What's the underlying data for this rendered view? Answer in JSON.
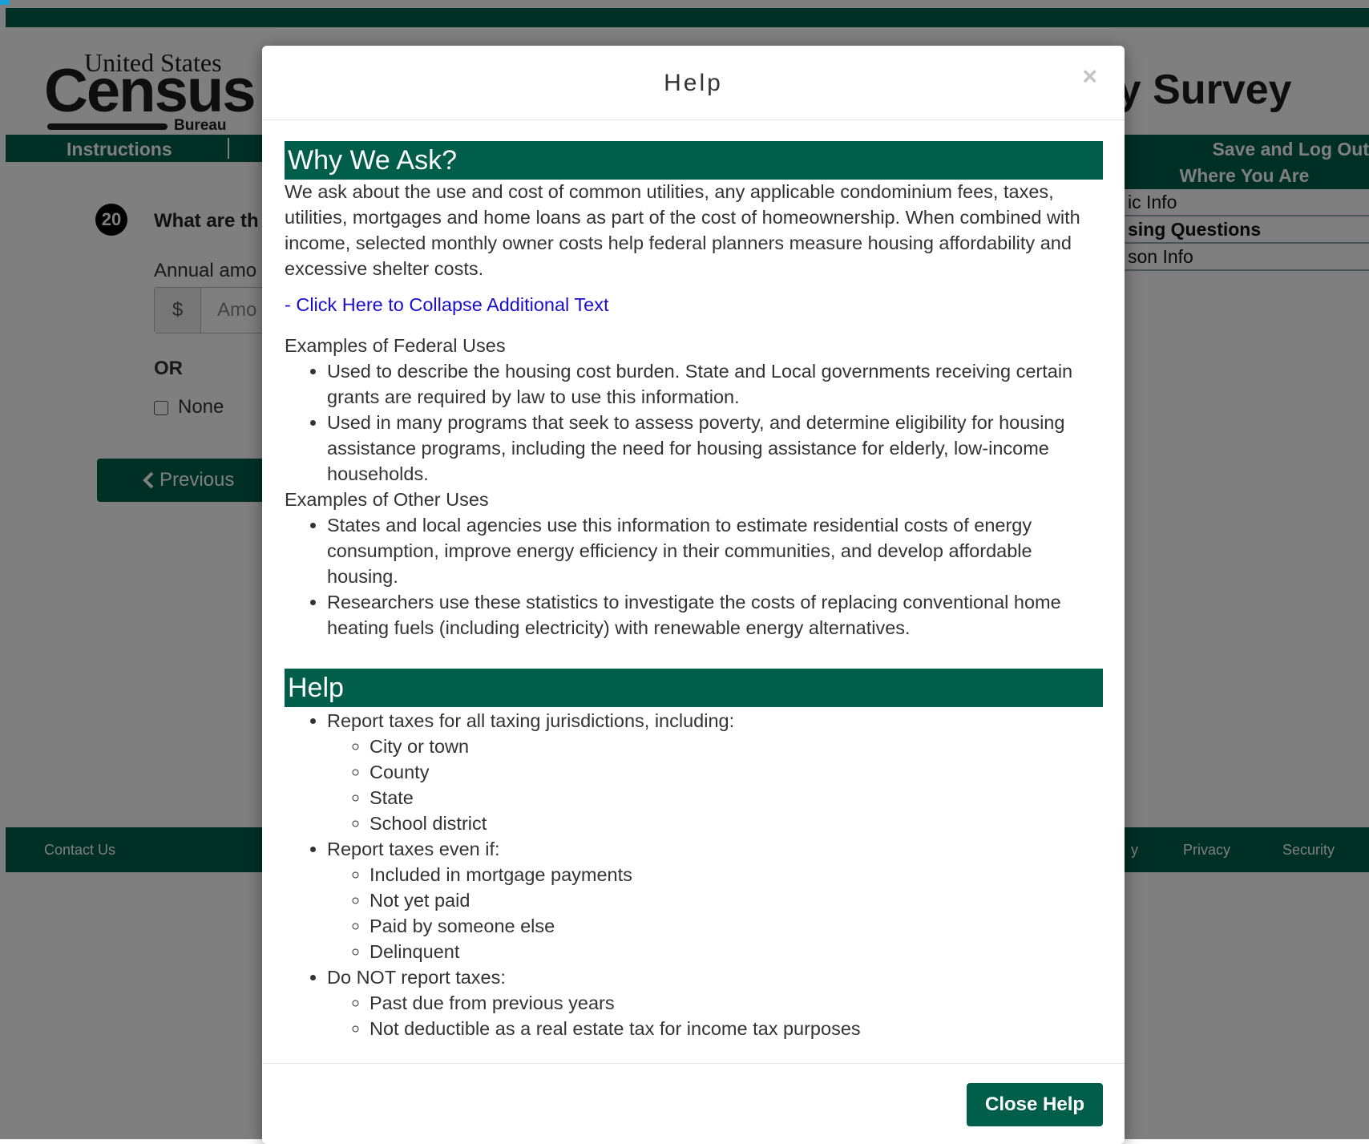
{
  "background": {
    "logo": {
      "top_line": "United States",
      "word": "Census",
      "bureau": "Bureau"
    },
    "survey_title": "ity Survey",
    "nav": {
      "instructions": "Instructions",
      "save_logout": "Save and Log Out"
    },
    "sidebar": {
      "title": "Where You Are",
      "items": [
        {
          "label": "ic Info"
        },
        {
          "label": "sing Questions"
        },
        {
          "label": "son Info"
        }
      ]
    },
    "question": {
      "number": "20",
      "text": "What are th",
      "annual_label": "Annual amo",
      "currency": "$",
      "placeholder": "Amo",
      "or_label": "OR",
      "none_label": "None",
      "previous_label": "Previous"
    },
    "footer": {
      "contact": "Contact Us",
      "privacy": "Privacy",
      "security": "Security",
      "partial": "y"
    }
  },
  "modal": {
    "title": "Help",
    "close_x": "×",
    "why_heading": "Why We Ask?",
    "why_text": "We ask about the use and cost of common utilities, any applicable condominium fees, taxes, utilities, mortgages and home loans as part of the cost of homeownership. When combined with income, selected monthly owner costs help federal planners measure housing affordability and excessive shelter costs.",
    "collapse_link": "- Click Here to Collapse Additional Text",
    "federal_heading": "Examples of Federal Uses",
    "federal_uses": [
      "Used to describe the housing cost burden. State and Local governments receiving certain grants are required by law to use this information.",
      "Used in many programs that seek to assess poverty, and determine eligibility for housing assistance programs, including the need for housing assistance for elderly, low-income households."
    ],
    "other_heading": "Examples of Other Uses",
    "other_uses": [
      "States and local agencies use this information to estimate residential costs of energy consumption, improve energy efficiency in their communities, and develop affordable housing.",
      "Researchers use these statistics to investigate the costs of replacing conventional home heating fuels (including electricity) with renewable energy alternatives."
    ],
    "help_heading": "Help",
    "help_groups": [
      {
        "label": "Report taxes for all taxing jurisdictions, including:",
        "items": [
          "City or town",
          "County",
          "State",
          "School district"
        ]
      },
      {
        "label": "Report taxes even if:",
        "items": [
          "Included in mortgage payments",
          "Not yet paid",
          "Paid by someone else",
          "Delinquent"
        ]
      },
      {
        "label": "Do NOT report taxes:",
        "items": [
          "Past due from previous years",
          "Not deductible as a real estate tax for income tax purposes"
        ]
      }
    ],
    "close_button": "Close Help"
  },
  "colors": {
    "brand_green": "#005e4a",
    "link_blue": "#1a0dcc",
    "overlay": "rgba(0,0,0,0.5)"
  }
}
